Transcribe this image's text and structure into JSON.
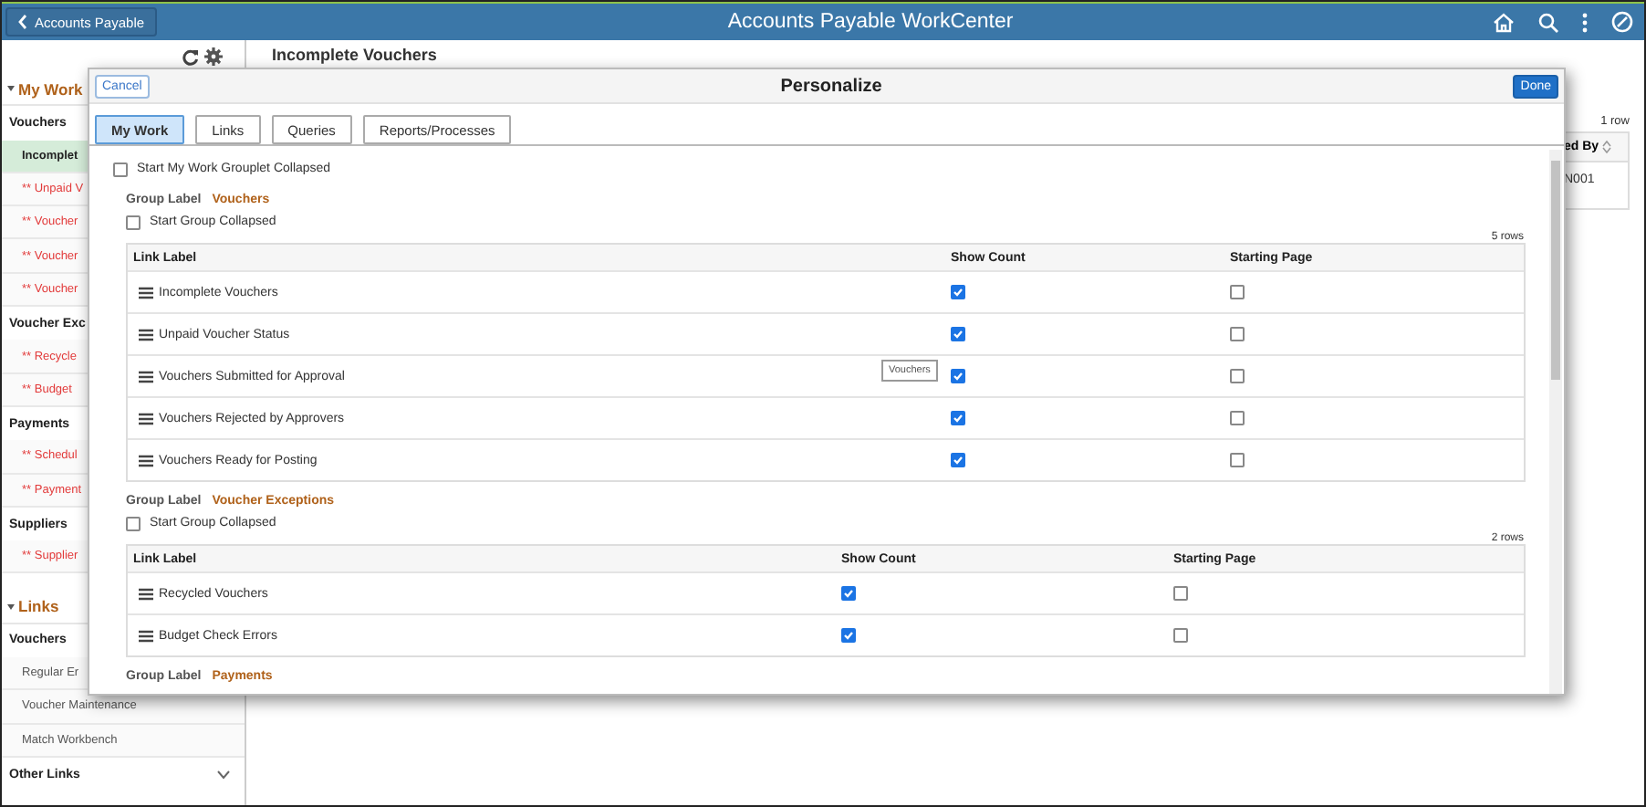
{
  "header": {
    "back_button": "Accounts Payable",
    "title": "Accounts Payable WorkCenter"
  },
  "sidebar": {
    "sections": [
      {
        "title": "My Work",
        "expanded": true,
        "groups": [
          {
            "title": "Vouchers",
            "items": [
              {
                "label": "Incomplet",
                "kind": "alert",
                "selected": true
              },
              {
                "label": "** Unpaid V",
                "kind": "alert",
                "selected": false
              },
              {
                "label": "** Voucher",
                "kind": "alert",
                "selected": false
              },
              {
                "label": "** Voucher",
                "kind": "alert",
                "selected": false
              },
              {
                "label": "** Voucher",
                "kind": "alert",
                "selected": false
              }
            ]
          },
          {
            "title": "Voucher Exc",
            "items": [
              {
                "label": "** Recycle",
                "kind": "alert",
                "selected": false
              },
              {
                "label": "** Budget",
                "kind": "alert",
                "selected": false
              }
            ]
          },
          {
            "title": "Payments",
            "items": [
              {
                "label": "** Schedul",
                "kind": "alert",
                "selected": false
              },
              {
                "label": "** Payment",
                "kind": "alert",
                "selected": false
              }
            ]
          },
          {
            "title": "Suppliers",
            "items": [
              {
                "label": "** Supplier",
                "kind": "alert",
                "selected": false
              }
            ]
          }
        ]
      },
      {
        "title": "Links",
        "expanded": true,
        "groups": [
          {
            "title": "Vouchers",
            "items": [
              {
                "label": "Regular Er",
                "kind": "plain",
                "selected": false
              },
              {
                "label": "Voucher Maintenance",
                "kind": "plain",
                "selected": false
              },
              {
                "label": "Match Workbench",
                "kind": "plain",
                "selected": false
              }
            ]
          },
          {
            "title": "Other Links",
            "expanded": false
          }
        ]
      }
    ]
  },
  "main": {
    "title": "Incomplete Vouchers",
    "row_count": "1 row",
    "column": "ed By",
    "cell": "N001"
  },
  "modal": {
    "cancel": "Cancel",
    "title": "Personalize",
    "done": "Done",
    "tabs": [
      {
        "label": "My Work",
        "selected": true
      },
      {
        "label": "Links",
        "selected": false
      },
      {
        "label": "Queries",
        "selected": false
      },
      {
        "label": "Reports/Processes",
        "selected": false
      }
    ],
    "collapse_all": {
      "label": "Start My Work Grouplet Collapsed",
      "checked": false
    },
    "groups": [
      {
        "caption": "Group Label",
        "label": "Vouchers",
        "collapse": {
          "label": "Start Group Collapsed",
          "checked": false
        },
        "row_count": "5 rows",
        "columns": [
          "Link Label",
          "Show Count",
          "Starting Page"
        ],
        "rows": [
          {
            "label": "Incomplete Vouchers",
            "show_count": true,
            "starting_page": false
          },
          {
            "label": "Unpaid Voucher Status",
            "show_count": true,
            "starting_page": false
          },
          {
            "label": "Vouchers Submitted for Approval",
            "show_count": true,
            "starting_page": false,
            "tooltip": "Vouchers"
          },
          {
            "label": "Vouchers Rejected by Approvers",
            "show_count": true,
            "starting_page": false
          },
          {
            "label": "Vouchers Ready for Posting",
            "show_count": true,
            "starting_page": false
          }
        ]
      },
      {
        "caption": "Group Label",
        "label": "Voucher Exceptions",
        "collapse": {
          "label": "Start Group Collapsed",
          "checked": false
        },
        "row_count": "2 rows",
        "columns": [
          "Link Label",
          "Show Count",
          "Starting Page"
        ],
        "rows": [
          {
            "label": "Recycled Vouchers",
            "show_count": true,
            "starting_page": false
          },
          {
            "label": "Budget Check Errors",
            "show_count": true,
            "starting_page": false
          }
        ]
      },
      {
        "caption": "Group Label",
        "label": "Payments"
      }
    ]
  }
}
